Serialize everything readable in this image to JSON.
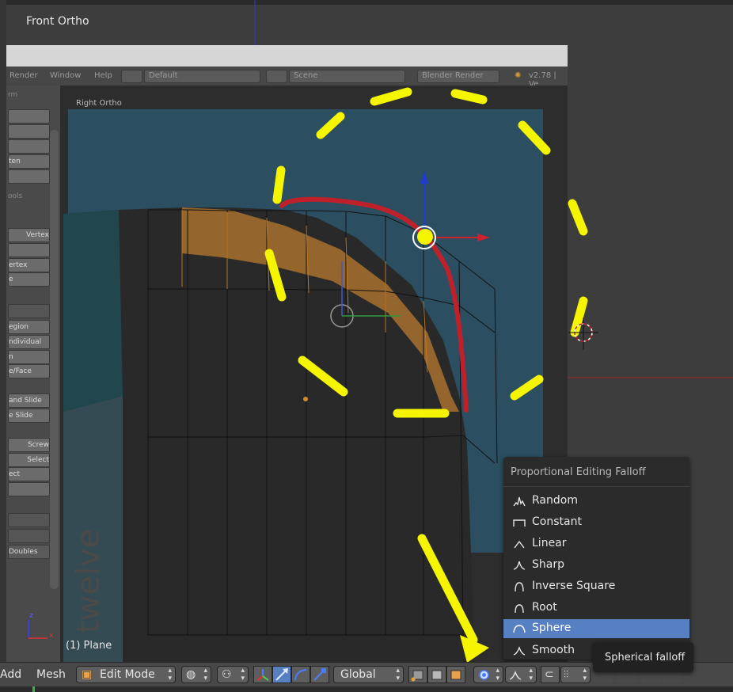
{
  "viewport": {
    "title": "Front Ortho",
    "object_label": "(1) Plane"
  },
  "inner": {
    "menus": [
      "Render",
      "Window",
      "Help"
    ],
    "layout_field": "Default",
    "scene_field": "Scene",
    "engine": "Blender Render",
    "version": "v2.78 | Ve",
    "view_label": "Right Ortho",
    "shelf_top": [
      "rm"
    ],
    "shelf_sections": [
      "ools"
    ],
    "shelf_buttons": [
      "",
      "",
      "",
      "ten",
      "",
      "Vertex",
      "",
      "ertex",
      "e",
      "egion",
      "ndividual",
      "n",
      "e/Face",
      "and Slide",
      "e Slide",
      "Screw",
      "Select",
      "ect",
      "Doubles"
    ],
    "watermark": "twelve"
  },
  "header": {
    "add": "Add",
    "mesh": "Mesh",
    "mode": "Edit Mode",
    "orientation": "Global"
  },
  "falloff_menu": {
    "title": "Proportional Editing Falloff",
    "items": [
      {
        "label": "Random",
        "icon": "random-falloff-icon"
      },
      {
        "label": "Constant",
        "icon": "constant-falloff-icon"
      },
      {
        "label": "Linear",
        "icon": "linear-falloff-icon"
      },
      {
        "label": "Sharp",
        "icon": "sharp-falloff-icon"
      },
      {
        "label": "Inverse Square",
        "icon": "inverse-square-falloff-icon"
      },
      {
        "label": "Root",
        "icon": "root-falloff-icon"
      },
      {
        "label": "Sphere",
        "icon": "sphere-falloff-icon"
      },
      {
        "label": "Smooth",
        "icon": "smooth-falloff-icon"
      }
    ],
    "selected": "Sphere"
  },
  "tooltip": "Spherical falloff",
  "colors": {
    "selection_blue": "#5680c2",
    "annotation_yellow": "#f5f500",
    "annotation_red": "#c0202a",
    "mesh_orange": "#d78a2a"
  }
}
